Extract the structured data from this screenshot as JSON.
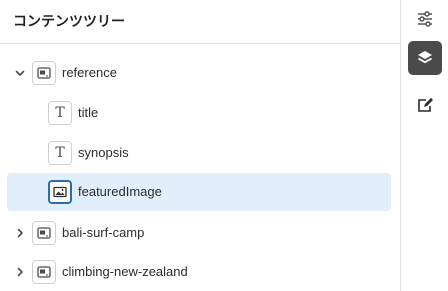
{
  "panel": {
    "title": "コンテンツツリー"
  },
  "tree": [
    {
      "label": "reference",
      "type": "fragment",
      "expanded": true,
      "level": 0,
      "selected": false
    },
    {
      "label": "title",
      "type": "text",
      "level": 1,
      "selected": false
    },
    {
      "label": "synopsis",
      "type": "text",
      "level": 1,
      "selected": false
    },
    {
      "label": "featuredImage",
      "type": "image",
      "level": 1,
      "selected": true
    },
    {
      "label": "bali-surf-camp",
      "type": "fragment",
      "expanded": false,
      "level": 0,
      "selected": false
    },
    {
      "label": "climbing-new-zealand",
      "type": "fragment",
      "expanded": false,
      "level": 0,
      "selected": false
    }
  ],
  "rail": [
    {
      "icon": "properties-sliders-icon",
      "active": false
    },
    {
      "icon": "layers-icon",
      "active": true
    },
    {
      "icon": "edit-note-icon",
      "active": false
    }
  ],
  "colors": {
    "selected_bg": "#e1eefb",
    "selected_border": "#2b6cb0",
    "rail_active": "#4b4b4b"
  },
  "glyphs": {
    "text_type": "T"
  }
}
